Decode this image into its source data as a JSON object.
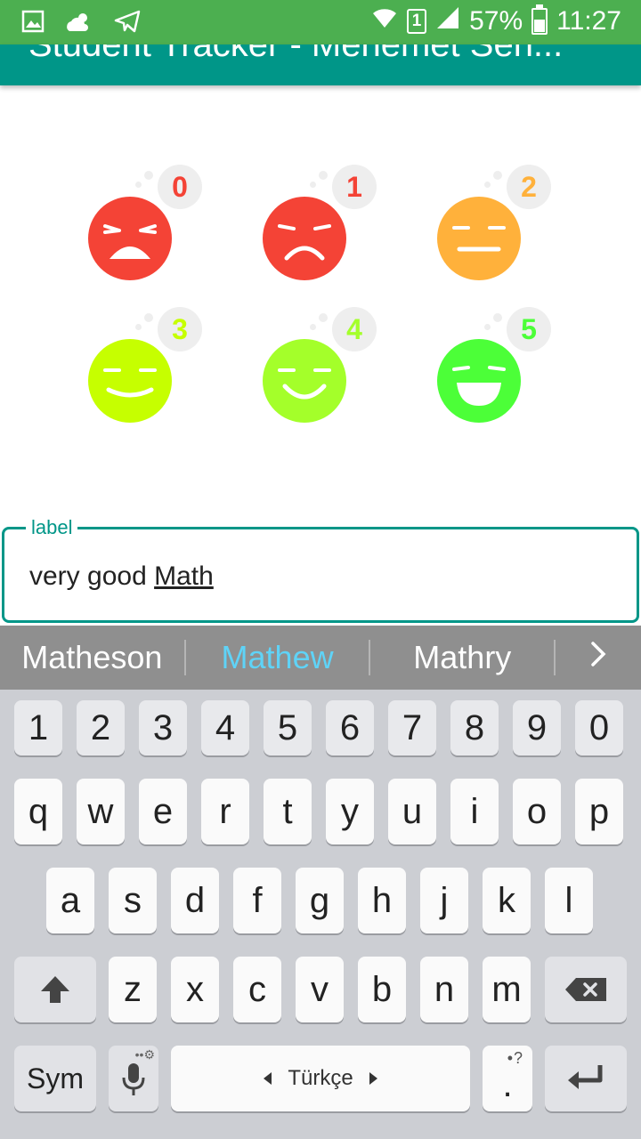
{
  "status_bar": {
    "battery_percent": "57%",
    "time": "11:27",
    "sim": "1",
    "icons": [
      "gallery-icon",
      "weather-icon",
      "telegram-icon",
      "wifi-icon",
      "sim-icon",
      "signal-icon",
      "battery-icon"
    ]
  },
  "app_bar": {
    "title": "Student Tracker - Mehemet Sen..."
  },
  "ratings": [
    {
      "value": "0",
      "color": "#f44336",
      "mood": "crying"
    },
    {
      "value": "1",
      "color": "#f44336",
      "mood": "sad"
    },
    {
      "value": "2",
      "color": "#ffb13b",
      "mood": "neutral"
    },
    {
      "value": "3",
      "color": "#c6ff00",
      "mood": "slight-smile"
    },
    {
      "value": "4",
      "color": "#a4ff2a",
      "mood": "smile"
    },
    {
      "value": "5",
      "color": "#4cff38",
      "mood": "laugh"
    }
  ],
  "label_field": {
    "label": "label",
    "value_prefix": "very good ",
    "composing_word": "Math"
  },
  "suggestions": {
    "items": [
      "Matheson",
      "Mathew",
      "Mathry"
    ],
    "primary_index": 1
  },
  "keyboard": {
    "row_numbers": [
      "1",
      "2",
      "3",
      "4",
      "5",
      "6",
      "7",
      "8",
      "9",
      "0"
    ],
    "row_1": [
      "q",
      "w",
      "e",
      "r",
      "t",
      "y",
      "u",
      "i",
      "o",
      "p"
    ],
    "row_2": [
      "a",
      "s",
      "d",
      "f",
      "g",
      "h",
      "j",
      "k",
      "l"
    ],
    "row_3": [
      "z",
      "x",
      "c",
      "v",
      "b",
      "n",
      "m"
    ],
    "sym_label": "Sym",
    "space_label": "Türkçe",
    "period_label": ".",
    "period_sub": "•?"
  },
  "colors": {
    "status_bar": "#4CAF50",
    "app_bar": "#009688",
    "accent": "#009688",
    "suggestion_bar": "#8f8f8f",
    "suggestion_primary": "#5fd3f7",
    "keyboard_bg": "#ccced3"
  }
}
